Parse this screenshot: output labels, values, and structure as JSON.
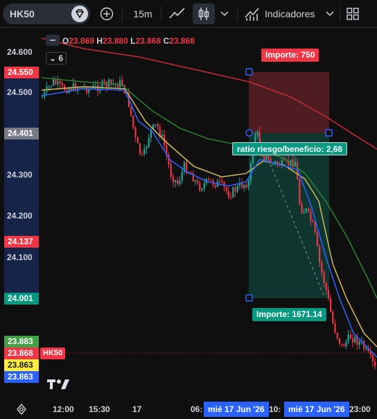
{
  "toolbar": {
    "symbol": "HK50",
    "interval": "15m",
    "indicators_label": "Indicadores"
  },
  "legend": {
    "o_label": "O",
    "o_value": "23.869",
    "h_label": "H",
    "h_value": "23.880",
    "l_label": "L",
    "l_value": "23.868",
    "c_label": "C",
    "c_value": "23.868",
    "indicator_count": "6"
  },
  "price_axis": {
    "ticks": [
      "24.600",
      "24.500",
      "24.300",
      "24.200",
      "24.100"
    ],
    "labels": {
      "stop": "24.550",
      "entry": "24.401",
      "mid": "24.137",
      "target": "24.001",
      "ma1": "23.883",
      "last": "23.868",
      "ma2": "23.863",
      "ma3": "23.863"
    },
    "symbol_tag": "HK50"
  },
  "position_tool": {
    "stop_label": "Importe: 750",
    "ratio_label": "ratio riesgo/beneficio: 2,68",
    "target_label": "Importe: 1671.14"
  },
  "time_axis": {
    "ticks": [
      "12:00",
      "15:30",
      "17",
      "06:",
      "10:",
      "23:00"
    ],
    "highlight_1": "mié 17 Jun '26",
    "highlight_2": "mié 17 Jun '26"
  },
  "colors": {
    "bull": "#26a69a",
    "bear": "#f23645",
    "ma_red": "#b22833",
    "ma_green": "#2e7d32",
    "ma_yellow": "#c9b458",
    "ma_blue": "#2962ff",
    "accent": "#2962ff"
  }
}
